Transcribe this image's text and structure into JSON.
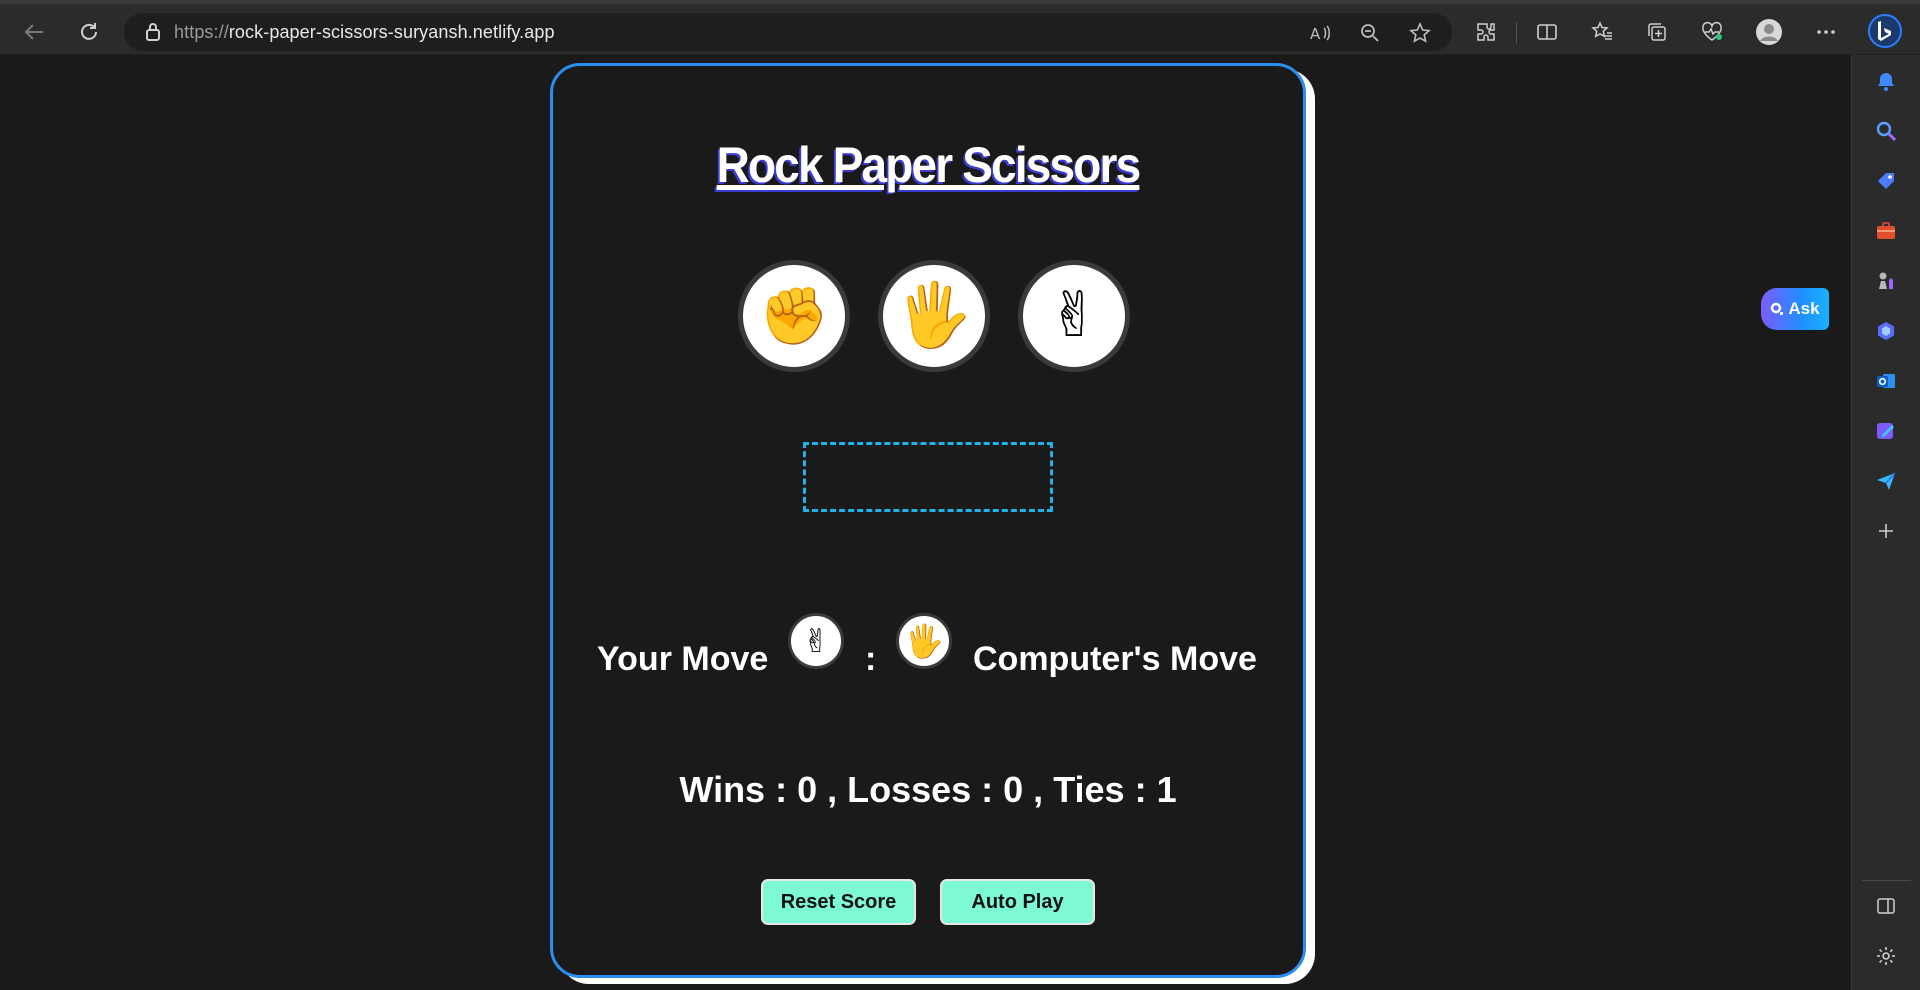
{
  "browser": {
    "url_protocol": "https://",
    "url_host": "rock-paper-scissors-suryansh.netlify.app"
  },
  "page": {
    "title": "Rock Paper Scissors",
    "choices": [
      {
        "name": "rock",
        "emoji": "✊"
      },
      {
        "name": "paper",
        "emoji": "🖐"
      },
      {
        "name": "scissors",
        "emoji": "✌"
      }
    ],
    "result_text": "",
    "your_move_label": "Your Move",
    "your_move_emoji": "✌",
    "separator": ":",
    "computer_move_label": "Computer's Move",
    "computer_move_emoji": "🖐",
    "score_text": "Wins : 0 , Losses : 0 , Ties : 1",
    "reset_button": "Reset Score",
    "autoplay_button": "Auto Play"
  },
  "ask_button": {
    "label": "Ask"
  },
  "colors": {
    "card_border": "#2a8df2",
    "button_bg": "#7df9d6",
    "result_border": "#1fb3ea",
    "page_bg": "#1a1a1a"
  }
}
